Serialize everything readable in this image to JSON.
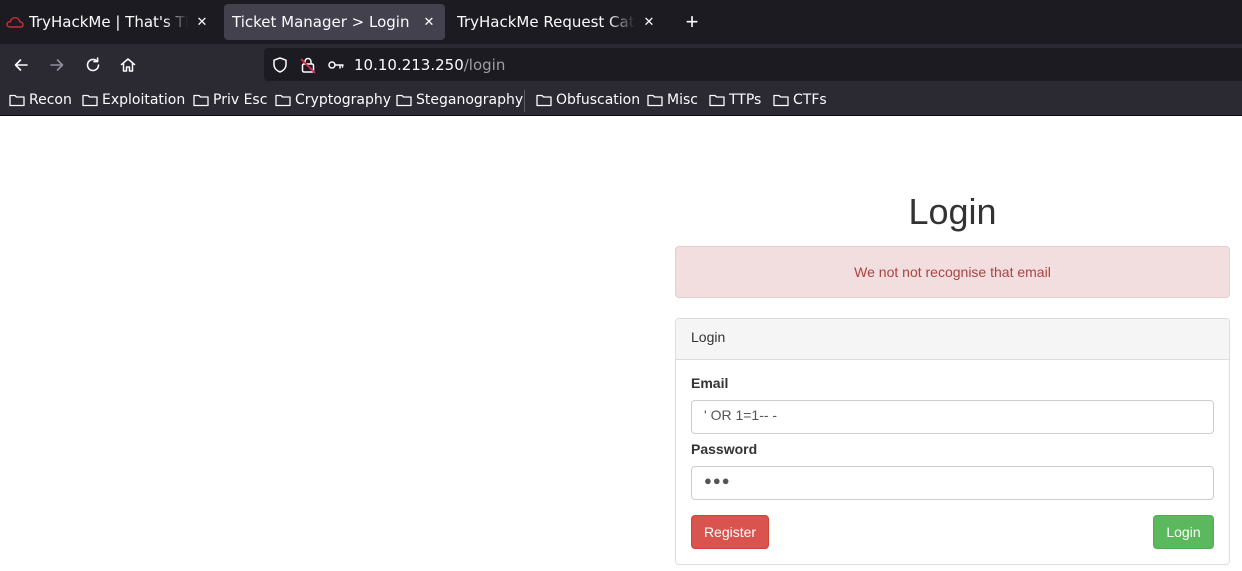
{
  "browser": {
    "tabs": [
      {
        "title": "TryHackMe | That's The Ticket",
        "active": false
      },
      {
        "title": "Ticket Manager > Login",
        "active": true
      },
      {
        "title": "TryHackMe Request Catcher",
        "active": false
      }
    ],
    "new_tab_symbol": "+",
    "close_symbol": "✕",
    "url": {
      "host": "10.10.213.250",
      "path": "/login"
    },
    "bookmarks": [
      "Recon",
      "Exploitation",
      "Priv Esc",
      "Cryptography",
      "Steganography",
      "Obfuscation",
      "Misc",
      "TTPs",
      "CTFs"
    ]
  },
  "page": {
    "heading": "Login",
    "alert": "We not not recognise that email",
    "panel_title": "Login",
    "email_label": "Email",
    "email_value": "' OR 1=1-- -",
    "password_label": "Password",
    "password_masked": "●●●",
    "register_label": "Register",
    "login_label": "Login"
  },
  "colors": {
    "tabbar_bg": "#1c1b22",
    "toolbar_bg": "#2b2a33",
    "alert_bg": "#f2dede",
    "alert_text": "#a94442",
    "register_btn": "#d9534f",
    "login_btn": "#5cb85c"
  }
}
